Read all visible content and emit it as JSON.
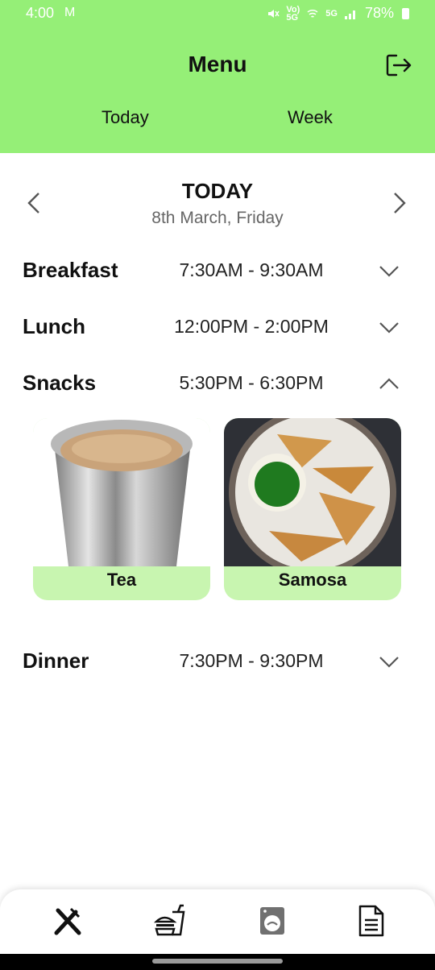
{
  "status_bar": {
    "time": "4:00",
    "battery": "78%",
    "net_vol": "Vo)",
    "net_5g": "5G",
    "sim_5g": "5G"
  },
  "header": {
    "title": "Menu",
    "tabs": [
      "Today",
      "Week"
    ]
  },
  "day": {
    "title": "TODAY",
    "date": "8th March, Friday"
  },
  "meals": [
    {
      "name": "Breakfast",
      "time": "7:30AM - 9:30AM",
      "expanded": false
    },
    {
      "name": "Lunch",
      "time": "12:00PM - 2:00PM",
      "expanded": false
    },
    {
      "name": "Snacks",
      "time": "5:30PM - 6:30PM",
      "expanded": true
    },
    {
      "name": "Dinner",
      "time": "7:30PM - 9:30PM",
      "expanded": false
    }
  ],
  "snacks_items": [
    {
      "label": "Tea"
    },
    {
      "label": "Samosa"
    }
  ],
  "bottom_nav": [
    "fork-knife-icon",
    "burger-drink-icon",
    "washing-machine-icon",
    "document-icon"
  ],
  "colors": {
    "header_bg": "#95ef77",
    "card_bg": "#c8f5b0"
  }
}
